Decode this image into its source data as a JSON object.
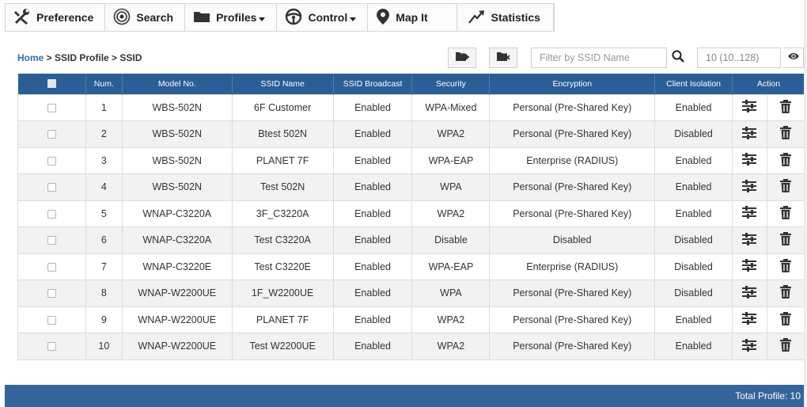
{
  "toolbar": {
    "items": [
      {
        "label": "Preference",
        "icon": "tools-icon"
      },
      {
        "label": "Search",
        "icon": "radar-icon"
      },
      {
        "label": "Profiles",
        "icon": "folder-icon",
        "dropdown": true
      },
      {
        "label": "Control",
        "icon": "steering-wheel-icon",
        "dropdown": true
      },
      {
        "label": "Map It",
        "icon": "map-pin-icon"
      },
      {
        "label": "Statistics",
        "icon": "trend-arrow-icon"
      }
    ]
  },
  "breadcrumb": {
    "home": "Home",
    "sep1": " > ",
    "profile": "SSID Profile",
    "sep2": " > ",
    "current": "SSID"
  },
  "filter": {
    "placeholder": "Filter by SSID Name",
    "page_size": "10 (10..128)"
  },
  "table": {
    "headers": [
      "Num.",
      "Model No.",
      "SSID Name",
      "SSID Broadcast",
      "Security",
      "Encryption",
      "Client Isolation",
      "Action"
    ],
    "rows": [
      {
        "num": "1",
        "model": "WBS-502N",
        "ssid": "6F Customer",
        "broadcast": "Enabled",
        "security": "WPA-Mixed",
        "encryption": "Personal (Pre-Shared Key)",
        "isolation": "Enabled"
      },
      {
        "num": "2",
        "model": "WBS-502N",
        "ssid": "Btest 502N",
        "broadcast": "Enabled",
        "security": "WPA2",
        "encryption": "Personal (Pre-Shared Key)",
        "isolation": "Disabled"
      },
      {
        "num": "3",
        "model": "WBS-502N",
        "ssid": "PLANET 7F",
        "broadcast": "Enabled",
        "security": "WPA-EAP",
        "encryption": "Enterprise (RADIUS)",
        "isolation": "Enabled"
      },
      {
        "num": "4",
        "model": "WBS-502N",
        "ssid": "Test 502N",
        "broadcast": "Enabled",
        "security": "WPA",
        "encryption": "Personal (Pre-Shared Key)",
        "isolation": "Enabled"
      },
      {
        "num": "5",
        "model": "WNAP-C3220A",
        "ssid": "3F_C3220A",
        "broadcast": "Enabled",
        "security": "WPA2",
        "encryption": "Personal (Pre-Shared Key)",
        "isolation": "Enabled"
      },
      {
        "num": "6",
        "model": "WNAP-C3220A",
        "ssid": "Test C3220A",
        "broadcast": "Enabled",
        "security": "Disable",
        "encryption": "Disabled",
        "isolation": "Disabled"
      },
      {
        "num": "7",
        "model": "WNAP-C3220E",
        "ssid": "Test C3220E",
        "broadcast": "Enabled",
        "security": "WPA-EAP",
        "encryption": "Enterprise (RADIUS)",
        "isolation": "Disabled"
      },
      {
        "num": "8",
        "model": "WNAP-W2200UE",
        "ssid": "1F_W2200UE",
        "broadcast": "Enabled",
        "security": "WPA",
        "encryption": "Personal (Pre-Shared Key)",
        "isolation": "Disabled"
      },
      {
        "num": "9",
        "model": "WNAP-W2200UE",
        "ssid": "PLANET 7F",
        "broadcast": "Enabled",
        "security": "WPA2",
        "encryption": "Personal (Pre-Shared Key)",
        "isolation": "Enabled"
      },
      {
        "num": "10",
        "model": "WNAP-W2200UE",
        "ssid": "Test W2200UE",
        "broadcast": "Enabled",
        "security": "WPA2",
        "encryption": "Personal (Pre-Shared Key)",
        "isolation": "Enabled"
      }
    ]
  },
  "footer": {
    "total": "Total Profile: 10"
  },
  "colors": {
    "header_bg": "#2b5d97",
    "footer_bg": "#36649b",
    "link": "#2f6fb3",
    "row_alt": "#f2f2f2"
  }
}
